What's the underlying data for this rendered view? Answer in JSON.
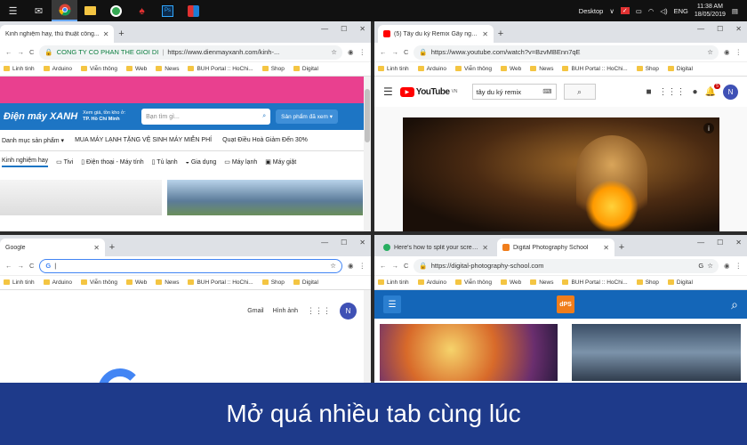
{
  "taskbar": {
    "icons": [
      "notification-center-icon",
      "mail-icon",
      "chrome-icon",
      "file-explorer-icon",
      "maps-icon",
      "red-app-icon",
      "photoshop-icon",
      "tiles-app-icon"
    ],
    "desktop_label": "Desktop",
    "lang": "ENG",
    "time": "11:38 AM",
    "date": "18/05/2019"
  },
  "win1": {
    "tab_title": "Kinh nghiệm hay, thủ thuật công...",
    "url_company": "CONG TY CO PHAN THE GIOI DI",
    "url": "https://www.dienmayxanh.com/kinh-...",
    "bookmarks": [
      "Linh tinh",
      "Arduino",
      "Viễn thông",
      "Web",
      "News",
      "BUH Portal :: HoChi...",
      "Shop",
      "Digital"
    ],
    "logo": "Điện máy XANH",
    "location_top": "Xem giá, tồn kho ở:",
    "location": "TP. Hồ Chí Minh",
    "search_placeholder": "Bạn tìm gì...",
    "viewed": "Sản phẩm đã xem",
    "menu": "Danh mục sản phẩm",
    "promo1": "MUA MÁY LẠNH TẶNG VỆ SINH MÁY MIỄN PHÍ",
    "promo2": "Quạt Điều Hoà Giảm Đến 30%",
    "cats": [
      "Kinh nghiệm hay",
      "Tivi",
      "Điện thoại - Máy tính",
      "Tủ lạnh",
      "Gia dụng",
      "Máy lạnh",
      "Máy giặt"
    ]
  },
  "win2": {
    "tab_title": "(5) Tây du ký Remix Gây nghiện ...",
    "url": "https://www.youtube.com/watch?v=BzvMBEnn7qE",
    "bookmarks": [
      "Linh tinh",
      "Arduino",
      "Viễn thông",
      "Web",
      "News",
      "BUH Portal :: HoChi...",
      "Shop",
      "Digital"
    ],
    "logo": "YouTube",
    "logo_sup": "VN",
    "search_value": "tây du ký remix",
    "notif_count": "5",
    "avatar": "N"
  },
  "win3": {
    "tab_title": "Google",
    "bookmarks": [
      "Linh tinh",
      "Arduino",
      "Viễn thông",
      "Web",
      "News",
      "BUH Portal :: HoChi...",
      "Shop",
      "Digital"
    ],
    "gmail": "Gmail",
    "images": "Hình ảnh",
    "avatar": "N"
  },
  "win4": {
    "tab1_title": "Here's how to split your screen in...",
    "tab2_title": "Digital Photography School",
    "url": "https://digital-photography-school.com",
    "bookmarks": [
      "Linh tinh",
      "Arduino",
      "Viễn thông",
      "Web",
      "News",
      "BUH Portal :: HoChi...",
      "Shop",
      "Digital"
    ],
    "logo": "dPS"
  },
  "banner": {
    "text": "Mở quá nhiều tab cùng lúc"
  },
  "colors": {
    "banner_bg": "#1e3a8a",
    "dmx_pink": "#e9408f",
    "dmx_blue": "#1d75c4",
    "youtube_red": "#ff0000",
    "dps_blue": "#1466b8",
    "dps_orange": "#f07d1b"
  }
}
